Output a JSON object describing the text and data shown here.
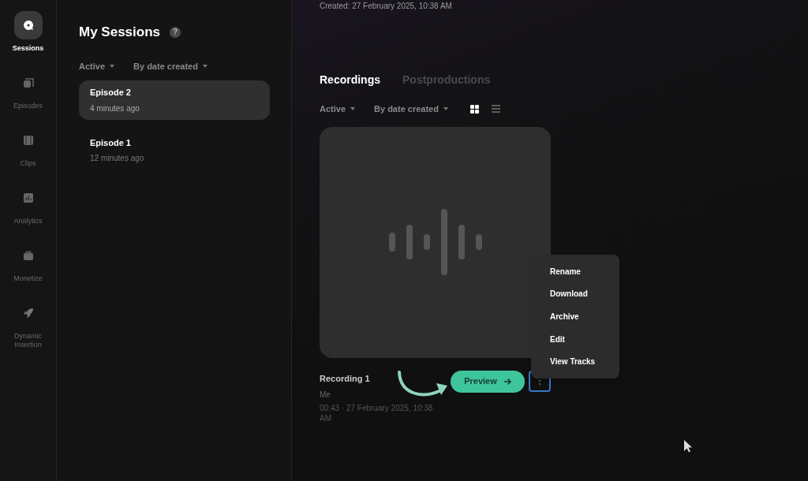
{
  "nav": [
    {
      "label": "Sessions",
      "selected": true
    },
    {
      "label": "Episodes",
      "selected": false
    },
    {
      "label": "Clips",
      "selected": false
    },
    {
      "label": "Analytics",
      "selected": false
    },
    {
      "label": "Monetize",
      "selected": false
    },
    {
      "label": "Dynamic Insertion",
      "selected": false
    }
  ],
  "sessions": {
    "title": "My Sessions",
    "help": "?",
    "filters": [
      "Active",
      "By date created"
    ],
    "items": [
      {
        "title": "Episode 2",
        "time": "4 minutes ago",
        "selected": true
      },
      {
        "title": "Episode 1",
        "time": "12 minutes ago",
        "selected": false
      }
    ]
  },
  "main": {
    "created": "Created: 27 February 2025, 10:38 AM",
    "tabs": [
      {
        "label": "Recordings",
        "selected": true
      },
      {
        "label": "Postproductions",
        "selected": false
      }
    ],
    "filters": [
      "Active",
      "By date created"
    ],
    "view_modes": [
      {
        "selected": true
      },
      {
        "selected": false
      }
    ],
    "recording": {
      "title": "Recording 1",
      "author": "Me",
      "meta": "00:43 · 27 February 2025, 10:38 AM",
      "preview": "Preview"
    },
    "menu": [
      "Rename",
      "Download",
      "Archive",
      "Edit",
      "View Tracks"
    ]
  }
}
